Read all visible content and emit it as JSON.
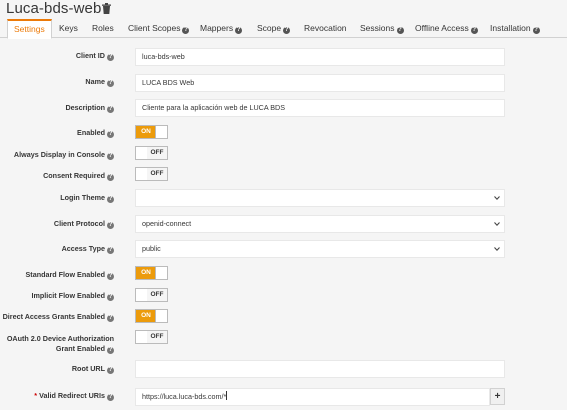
{
  "header": {
    "title": "Luca-bds-web"
  },
  "tabs": [
    {
      "label": "Settings",
      "help": false,
      "active": true
    },
    {
      "label": "Keys",
      "help": false
    },
    {
      "label": "Roles",
      "help": false
    },
    {
      "label": "Client Scopes",
      "help": true
    },
    {
      "label": "Mappers",
      "help": true
    },
    {
      "label": "Scope",
      "help": true
    },
    {
      "label": "Revocation",
      "help": false
    },
    {
      "label": "Sessions",
      "help": true
    },
    {
      "label": "Offline Access",
      "help": true
    },
    {
      "label": "Installation",
      "help": true
    }
  ],
  "form": {
    "client_id": {
      "label": "Client ID",
      "value": "luca-bds-web"
    },
    "name": {
      "label": "Name",
      "value": "LUCA BDS Web"
    },
    "description": {
      "label": "Description",
      "value": "Cliente para la aplicación web de LUCA BDS"
    },
    "enabled": {
      "label": "Enabled",
      "state": "ON"
    },
    "always_display": {
      "label": "Always Display in Console",
      "state": "OFF"
    },
    "consent_required": {
      "label": "Consent Required",
      "state": "OFF"
    },
    "login_theme": {
      "label": "Login Theme",
      "value": ""
    },
    "client_protocol": {
      "label": "Client Protocol",
      "value": "openid-connect"
    },
    "access_type": {
      "label": "Access Type",
      "value": "public"
    },
    "standard_flow": {
      "label": "Standard Flow Enabled",
      "state": "ON"
    },
    "implicit_flow": {
      "label": "Implicit Flow Enabled",
      "state": "OFF"
    },
    "direct_access": {
      "label": "Direct Access Grants Enabled",
      "state": "ON"
    },
    "device_auth_line1": "OAuth 2.0 Device Authorization",
    "device_auth_line2": "Grant Enabled",
    "device_auth_state": "OFF",
    "root_url": {
      "label": "Root URL",
      "value": ""
    },
    "redirect_uris": {
      "required_mark": "*",
      "label": "Valid Redirect URIs",
      "value": "https://luca.luca-bds.com/*"
    },
    "add_label": "+"
  },
  "icons": {
    "title_action": "trash-icon",
    "help": "question-circle-icon",
    "select": "chevron-down-icon"
  },
  "colors": {
    "accent": "#ec7a08",
    "switch_on": "#ec9b0b"
  }
}
